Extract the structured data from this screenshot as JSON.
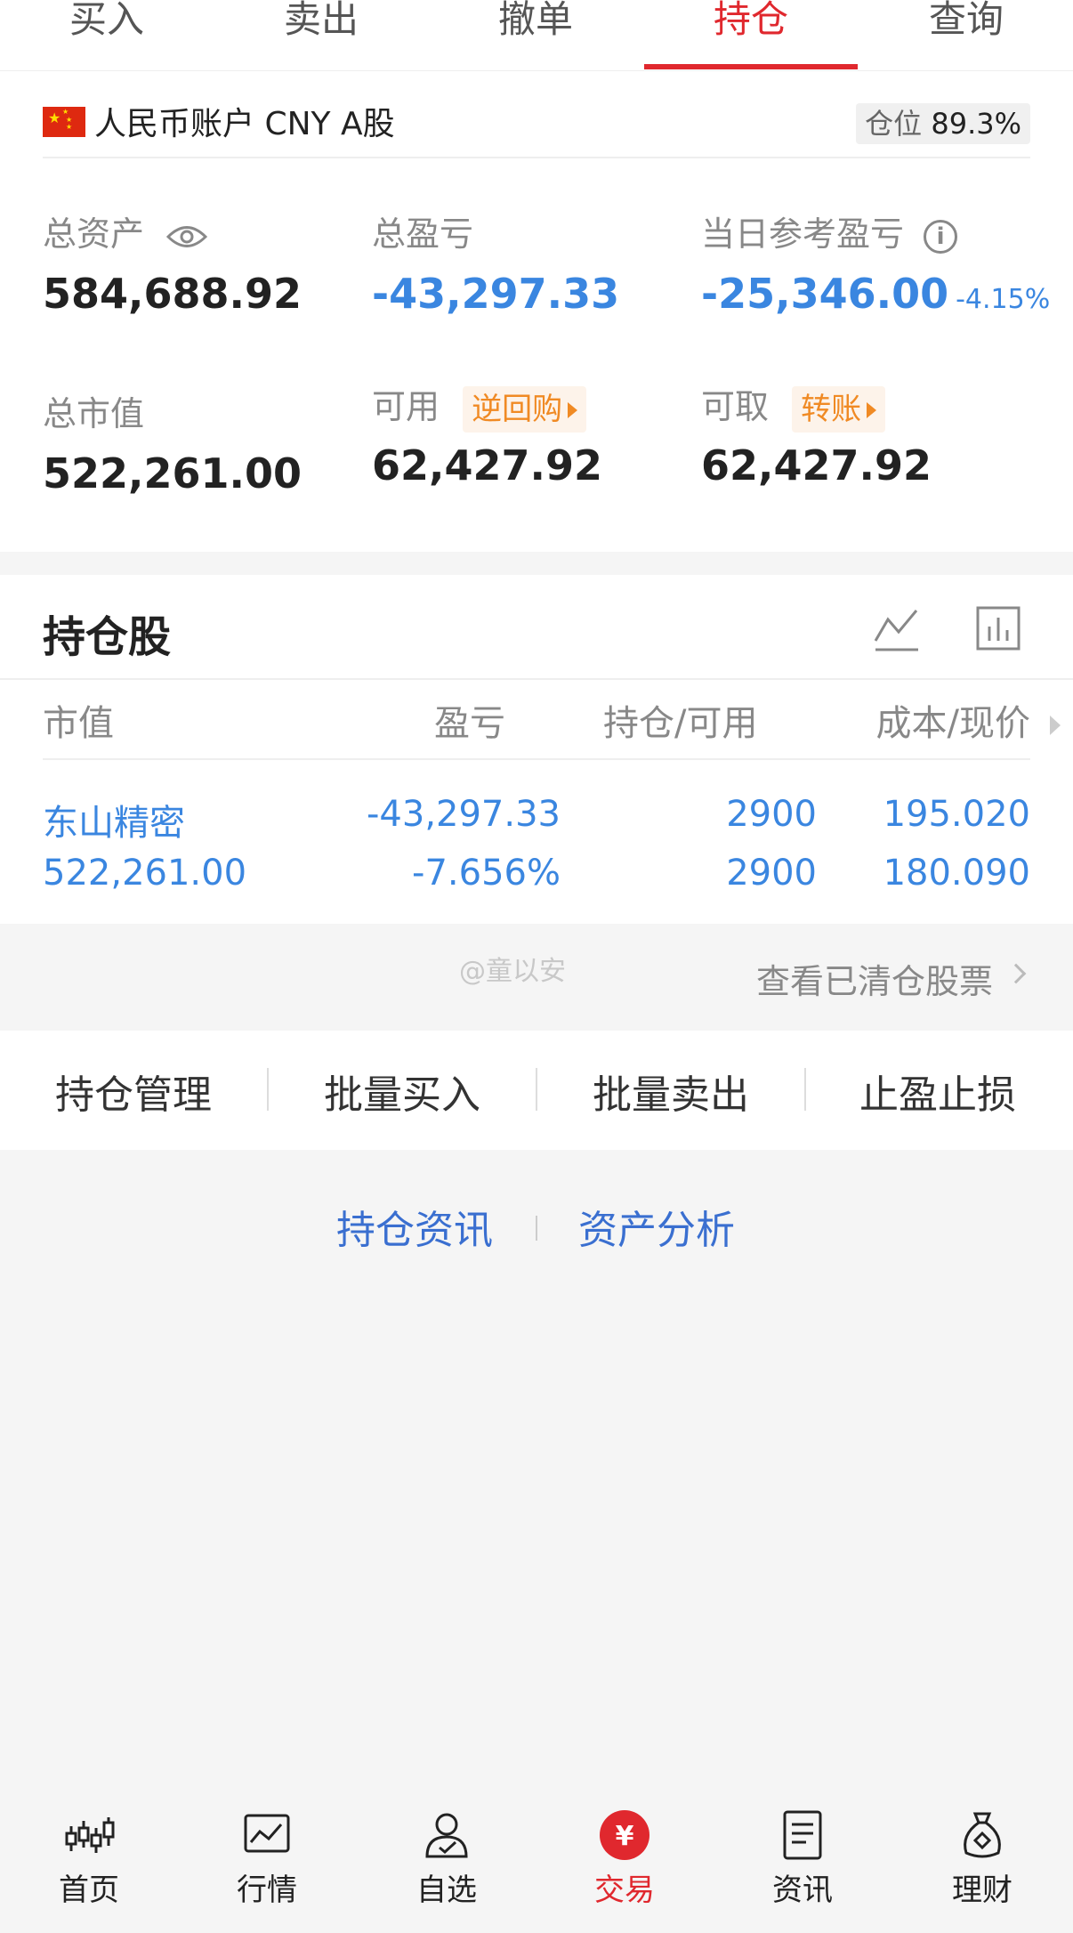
{
  "tabs": [
    {
      "label": "买入"
    },
    {
      "label": "卖出"
    },
    {
      "label": "撤单"
    },
    {
      "label": "持仓",
      "active": true
    },
    {
      "label": "查询"
    }
  ],
  "account": {
    "name": "人民币账户 CNY A股",
    "position_label": "仓位",
    "position_value": "89.3%"
  },
  "metrics": {
    "total_assets": {
      "label": "总资产",
      "value": "584,688.92"
    },
    "total_pnl": {
      "label": "总盈亏",
      "value": "-43,297.33"
    },
    "daily_pnl": {
      "label": "当日参考盈亏",
      "value": "-25,346.00",
      "pct": "-4.15%"
    },
    "market_value": {
      "label": "总市值",
      "value": "522,261.00"
    },
    "available": {
      "label": "可用",
      "tag": "逆回购",
      "value": "62,427.92"
    },
    "withdrawable": {
      "label": "可取",
      "tag": "转账",
      "value": "62,427.92"
    }
  },
  "holdings": {
    "title": "持仓股",
    "columns": [
      "市值",
      "盈亏",
      "持仓/可用",
      "成本/现价"
    ],
    "rows": [
      {
        "name": "东山精密",
        "market_value": "522,261.00",
        "pnl": "-43,297.33",
        "pnl_pct": "-7.656%",
        "holding": "2900",
        "available": "2900",
        "cost": "195.020",
        "price": "180.090"
      }
    ]
  },
  "watermark": "@童以安",
  "cleared_link": "查看已清仓股票",
  "actions": [
    "持仓管理",
    "批量买入",
    "批量卖出",
    "止盈止损"
  ],
  "links": [
    "持仓资讯",
    "资产分析"
  ],
  "bottom_nav": [
    {
      "label": "首页",
      "icon": "candlestick-icon"
    },
    {
      "label": "行情",
      "icon": "chart-icon"
    },
    {
      "label": "自选",
      "icon": "user-check-icon"
    },
    {
      "label": "交易",
      "icon": "yuan-icon",
      "active": true
    },
    {
      "label": "资讯",
      "icon": "document-icon"
    },
    {
      "label": "理财",
      "icon": "money-bag-icon"
    }
  ],
  "colors": {
    "accent": "#e0282e",
    "loss": "#3a86e0",
    "tag": "#f08a24"
  }
}
